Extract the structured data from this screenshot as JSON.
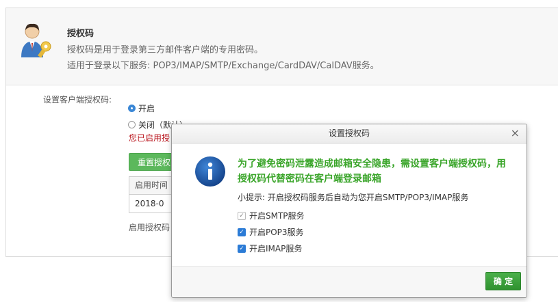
{
  "info": {
    "title": "授权码",
    "line1": "授权码是用于登录第三方邮件客户端的专用密码。",
    "line2": "适用于登录以下服务: POP3/IMAP/SMTP/Exchange/CardDAV/CalDAV服务。"
  },
  "settings": {
    "label": "设置客户端授权码:",
    "option_on": "开启",
    "option_off": "关闭（默认）",
    "enabled_tip": "您已启用授权码",
    "reset_button": "重置授权码",
    "table_header": "启用时间",
    "table_value": "2018-0",
    "bottom_note": "启用授权码"
  },
  "dialog": {
    "title": "设置授权码",
    "close_glyph": "×",
    "message": "为了避免密码泄露造成邮箱安全隐患，需设置客户端授权码，用授权码代替密码在客户端登录邮箱",
    "hint": "小提示: 开启授权码服务后自动为您开启SMTP/POP3/IMAP服务",
    "options": [
      {
        "label": "开启SMTP服务",
        "checked": true,
        "disabled": true
      },
      {
        "label": "开启POP3服务",
        "checked": true,
        "disabled": false
      },
      {
        "label": "开启IMAP服务",
        "checked": true,
        "disabled": false
      }
    ],
    "ok_button": "确 定"
  },
  "colors": {
    "accent_green": "#3aa52a",
    "button_green": "#5cb85c",
    "warning_red": "#b9141c",
    "checkbox_blue": "#2b7bd6",
    "info_icon_blue": "#1f5fb0"
  }
}
